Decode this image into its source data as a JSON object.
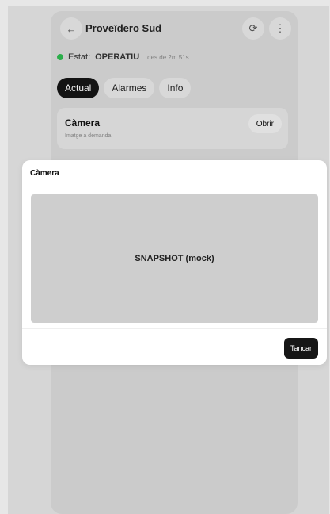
{
  "header": {
    "back_icon": "←",
    "title": "Proveïdero Sud",
    "refresh_icon": "⟳",
    "more_icon": "⋮"
  },
  "status": {
    "label": "Estat:",
    "value": "OPERATIU",
    "since": "des de 2m 51s",
    "color": "#2eb84e"
  },
  "tabs": [
    {
      "label": "Actual",
      "active": true
    },
    {
      "label": "Alarmes",
      "active": false
    },
    {
      "label": "Info",
      "active": false
    }
  ],
  "camera_card": {
    "title": "Càmera",
    "subtitle": "Imatge a demanda",
    "button": "Obrir"
  },
  "modal": {
    "title": "Càmera",
    "snapshot_text": "SNAPSHOT (mock)",
    "close_button": "Tancar"
  }
}
